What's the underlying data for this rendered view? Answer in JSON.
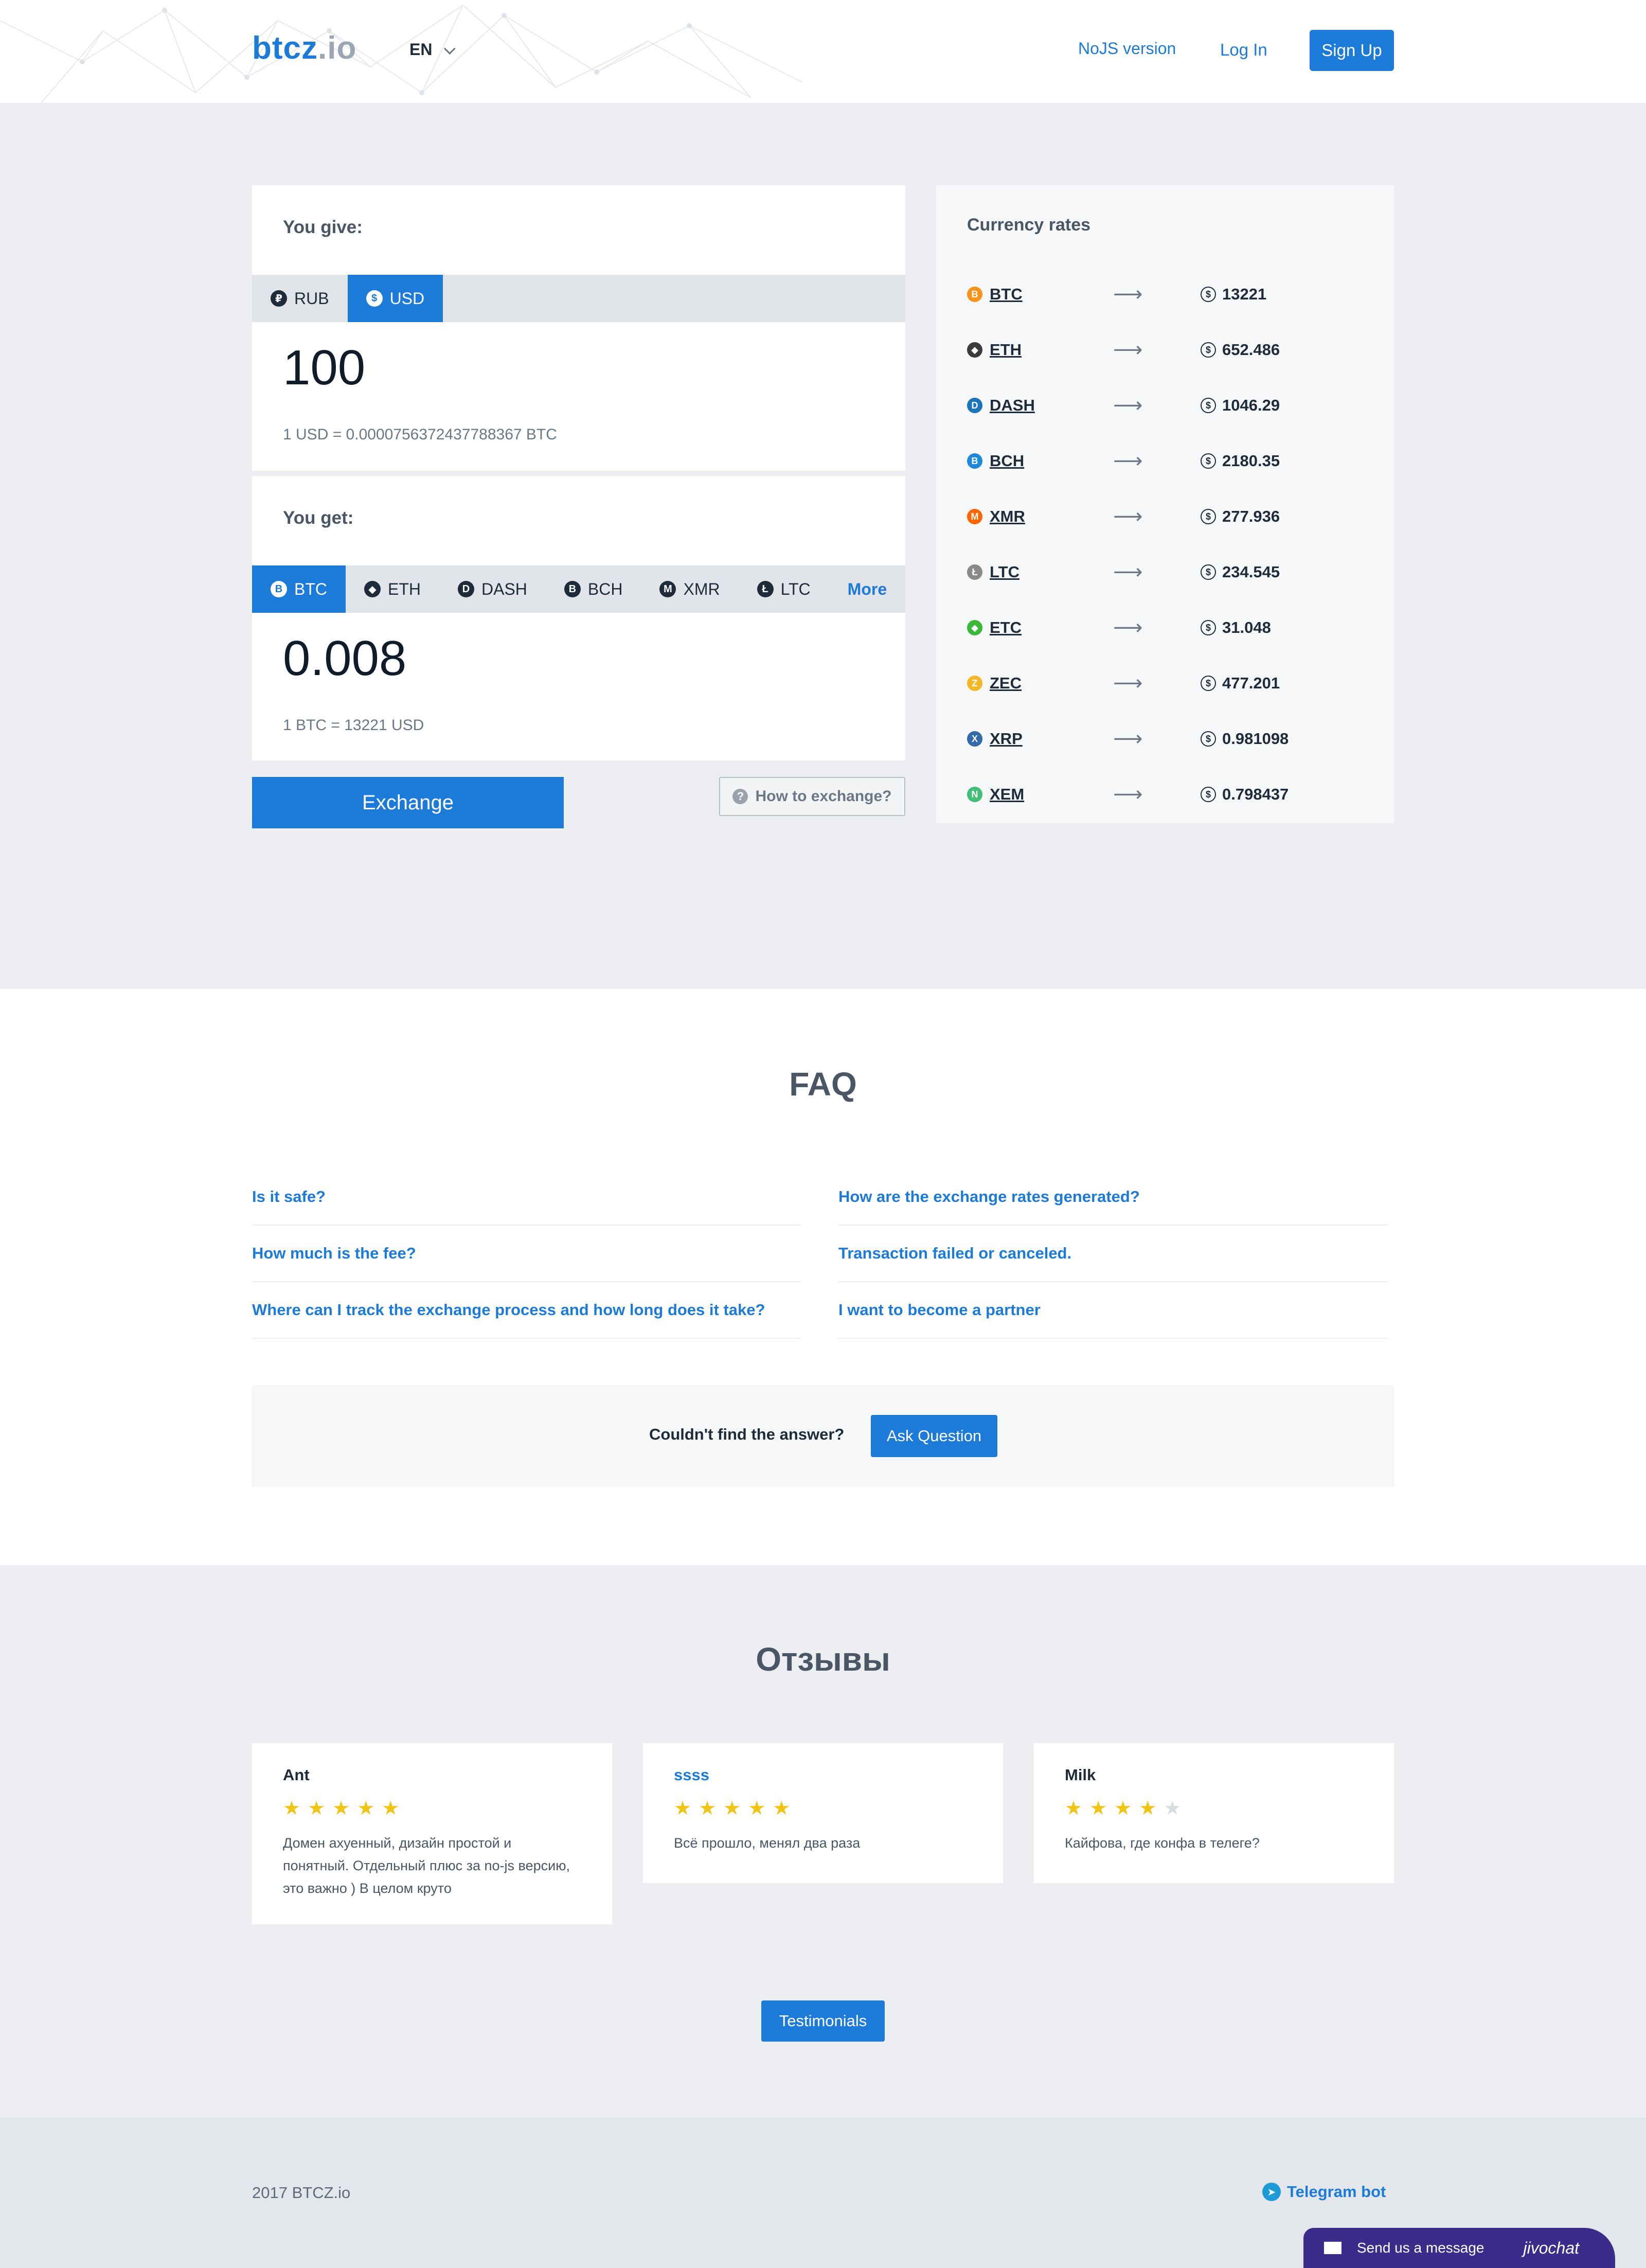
{
  "header": {
    "logo_main": "btcz",
    "logo_tld": ".io",
    "language": "EN",
    "nojs": "NoJS version",
    "login": "Log In",
    "signup": "Sign Up"
  },
  "give": {
    "label": "You give:",
    "tabs": [
      {
        "label": "RUB",
        "icon": "ruble-icon",
        "glyph": "₽"
      },
      {
        "label": "USD",
        "icon": "dollar-icon",
        "glyph": "$"
      }
    ],
    "active_tab": "USD",
    "amount": "100",
    "rate": "1 USD = 0.0000756372437788367 BTC"
  },
  "get": {
    "label": "You get:",
    "tabs": [
      {
        "label": "BTC",
        "icon": "bitcoin-icon",
        "glyph": "B"
      },
      {
        "label": "ETH",
        "icon": "ethereum-icon",
        "glyph": "◆"
      },
      {
        "label": "DASH",
        "icon": "dash-icon",
        "glyph": "D"
      },
      {
        "label": "BCH",
        "icon": "bitcoin-cash-icon",
        "glyph": "B"
      },
      {
        "label": "XMR",
        "icon": "monero-icon",
        "glyph": "M"
      },
      {
        "label": "LTC",
        "icon": "litecoin-icon",
        "glyph": "Ł"
      }
    ],
    "active_tab": "BTC",
    "more": "More",
    "amount": "0.008",
    "rate": "1 BTC = 13221 USD"
  },
  "exchange_button": "Exchange",
  "how_to": "How to exchange?",
  "rates": {
    "title": "Currency rates",
    "rows": [
      {
        "sym": "BTC",
        "val": "13221",
        "color": "#f7931a",
        "glyph": "B"
      },
      {
        "sym": "ETH",
        "val": "652.486",
        "color": "#3c3c3d",
        "glyph": "◆"
      },
      {
        "sym": "DASH",
        "val": "1046.29",
        "color": "#1c75bc",
        "glyph": "D"
      },
      {
        "sym": "BCH",
        "val": "2180.35",
        "color": "#1c8ad8",
        "glyph": "B"
      },
      {
        "sym": "XMR",
        "val": "277.936",
        "color": "#ff6600",
        "glyph": "M"
      },
      {
        "sym": "LTC",
        "val": "234.545",
        "color": "#8a8a8a",
        "glyph": "Ł"
      },
      {
        "sym": "ETC",
        "val": "31.048",
        "color": "#3ab83a",
        "glyph": "◆"
      },
      {
        "sym": "ZEC",
        "val": "477.201",
        "color": "#f4b728",
        "glyph": "Z"
      },
      {
        "sym": "XRP",
        "val": "0.981098",
        "color": "#346aa9",
        "glyph": "X"
      },
      {
        "sym": "XEM",
        "val": "0.798437",
        "color": "#41bf76",
        "glyph": "N"
      }
    ]
  },
  "faq": {
    "title": "FAQ",
    "left": [
      "Is it safe?",
      "How much is the fee?",
      "Where can I track the exchange process and how long does it take?"
    ],
    "right": [
      "How are the exchange rates generated?",
      "Transaction failed or canceled.",
      "I want to become a partner"
    ],
    "not_found": "Couldn't find the answer?",
    "ask": "Ask Question"
  },
  "reviews": {
    "title": "Отзывы",
    "items": [
      {
        "name": "Ant",
        "stars": 5,
        "text": "Домен ахуенный, дизайн простой и понятный. Отдельный плюс за no-js версию, это важно ) В целом круто"
      },
      {
        "name": "ssss",
        "stars": 5,
        "text": "Всё прошло, менял два раза"
      },
      {
        "name": "Milk",
        "stars": 4,
        "text": "Кайфова, где конфа в телеге?"
      }
    ],
    "button": "Testimonials"
  },
  "footer": {
    "copyright": "2017 BTCZ.io",
    "telegram": "Telegram bot"
  },
  "chat": {
    "message": "Send us a message",
    "brand": "jivochat"
  }
}
